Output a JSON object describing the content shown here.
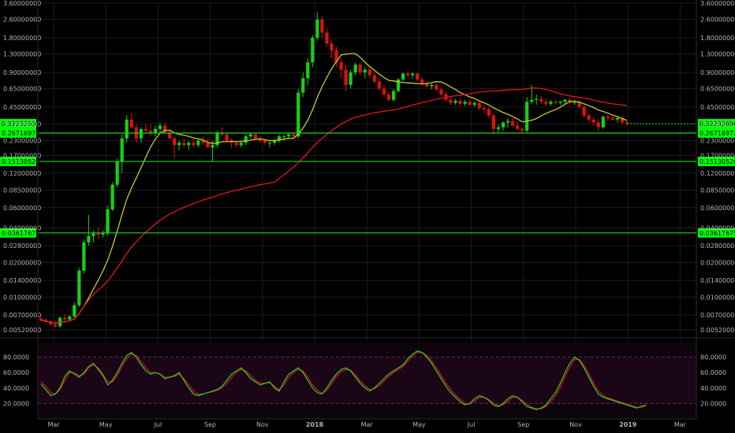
{
  "chart_data": {
    "type": "candlestick",
    "title": "",
    "y_scale": "log",
    "ylim": [
      0.0048,
      3.6
    ],
    "y_ticks": [
      "3.60000000",
      "2.60000000",
      "1.80000000",
      "1.30000000",
      "0.90000000",
      "0.65000000",
      "0.45000000",
      "0.32000000",
      "0.23000000",
      "0.17000000",
      "0.12000000",
      "0.08500000",
      "0.06000000",
      "0.04000000",
      "0.02800000",
      "0.02000000",
      "0.01400000",
      "0.01000000",
      "0.00700000",
      "0.00520000"
    ],
    "x_ticks": [
      "Mar",
      "May",
      "Jul",
      "Sep",
      "Nov",
      "2018",
      "Mar",
      "May",
      "Jul",
      "Sep",
      "Nov",
      "2019",
      "Mar"
    ],
    "current_price": {
      "label": "0.32232690",
      "value": 0.3223,
      "color": "#00ff00"
    },
    "horizontal_levels": [
      {
        "label": "0.26716972",
        "value": 0.2672
      },
      {
        "label": "0.15130520",
        "value": 0.1513
      },
      {
        "label": "0.03617675",
        "value": 0.0362
      }
    ],
    "candles": [
      {
        "week": 0,
        "o": 0.0065,
        "h": 0.0068,
        "l": 0.0062,
        "c": 0.0063
      },
      {
        "week": 1,
        "o": 0.0063,
        "h": 0.0066,
        "l": 0.006,
        "c": 0.0061
      },
      {
        "week": 2,
        "o": 0.0061,
        "h": 0.0064,
        "l": 0.0056,
        "c": 0.0058
      },
      {
        "week": 3,
        "o": 0.0058,
        "h": 0.0062,
        "l": 0.0054,
        "c": 0.0056
      },
      {
        "week": 4,
        "o": 0.0056,
        "h": 0.0068,
        "l": 0.0054,
        "c": 0.0066
      },
      {
        "week": 5,
        "o": 0.0066,
        "h": 0.0072,
        "l": 0.0062,
        "c": 0.0064
      },
      {
        "week": 6,
        "o": 0.0064,
        "h": 0.007,
        "l": 0.0062,
        "c": 0.0068
      },
      {
        "week": 7,
        "o": 0.0068,
        "h": 0.009,
        "l": 0.0066,
        "c": 0.0085
      },
      {
        "week": 8,
        "o": 0.0085,
        "h": 0.018,
        "l": 0.0082,
        "c": 0.017
      },
      {
        "week": 9,
        "o": 0.017,
        "h": 0.032,
        "l": 0.016,
        "c": 0.03
      },
      {
        "week": 10,
        "o": 0.03,
        "h": 0.052,
        "l": 0.028,
        "c": 0.034
      },
      {
        "week": 11,
        "o": 0.034,
        "h": 0.038,
        "l": 0.03,
        "c": 0.036
      },
      {
        "week": 12,
        "o": 0.036,
        "h": 0.04,
        "l": 0.032,
        "c": 0.035
      },
      {
        "week": 13,
        "o": 0.035,
        "h": 0.038,
        "l": 0.033,
        "c": 0.036
      },
      {
        "week": 14,
        "o": 0.036,
        "h": 0.062,
        "l": 0.034,
        "c": 0.058
      },
      {
        "week": 15,
        "o": 0.058,
        "h": 0.1,
        "l": 0.056,
        "c": 0.095
      },
      {
        "week": 16,
        "o": 0.095,
        "h": 0.16,
        "l": 0.09,
        "c": 0.15
      },
      {
        "week": 17,
        "o": 0.15,
        "h": 0.26,
        "l": 0.12,
        "c": 0.24
      },
      {
        "week": 18,
        "o": 0.24,
        "h": 0.38,
        "l": 0.22,
        "c": 0.35
      },
      {
        "week": 19,
        "o": 0.35,
        "h": 0.4,
        "l": 0.29,
        "c": 0.3
      },
      {
        "week": 20,
        "o": 0.3,
        "h": 0.32,
        "l": 0.22,
        "c": 0.24
      },
      {
        "week": 21,
        "o": 0.24,
        "h": 0.3,
        "l": 0.22,
        "c": 0.29
      },
      {
        "week": 22,
        "o": 0.29,
        "h": 0.32,
        "l": 0.27,
        "c": 0.28
      },
      {
        "week": 23,
        "o": 0.28,
        "h": 0.32,
        "l": 0.25,
        "c": 0.27
      },
      {
        "week": 24,
        "o": 0.27,
        "h": 0.31,
        "l": 0.25,
        "c": 0.29
      },
      {
        "week": 25,
        "o": 0.29,
        "h": 0.33,
        "l": 0.27,
        "c": 0.31
      },
      {
        "week": 26,
        "o": 0.31,
        "h": 0.33,
        "l": 0.27,
        "c": 0.27
      },
      {
        "week": 27,
        "o": 0.27,
        "h": 0.29,
        "l": 0.24,
        "c": 0.24
      },
      {
        "week": 28,
        "o": 0.24,
        "h": 0.25,
        "l": 0.16,
        "c": 0.21
      },
      {
        "week": 29,
        "o": 0.21,
        "h": 0.23,
        "l": 0.19,
        "c": 0.22
      },
      {
        "week": 30,
        "o": 0.22,
        "h": 0.24,
        "l": 0.2,
        "c": 0.21
      },
      {
        "week": 31,
        "o": 0.21,
        "h": 0.23,
        "l": 0.19,
        "c": 0.22
      },
      {
        "week": 32,
        "o": 0.22,
        "h": 0.24,
        "l": 0.2,
        "c": 0.21
      },
      {
        "week": 33,
        "o": 0.21,
        "h": 0.24,
        "l": 0.2,
        "c": 0.23
      },
      {
        "week": 34,
        "o": 0.23,
        "h": 0.25,
        "l": 0.21,
        "c": 0.22
      },
      {
        "week": 35,
        "o": 0.22,
        "h": 0.24,
        "l": 0.2,
        "c": 0.2
      },
      {
        "week": 36,
        "o": 0.2,
        "h": 0.23,
        "l": 0.15,
        "c": 0.21
      },
      {
        "week": 37,
        "o": 0.21,
        "h": 0.28,
        "l": 0.2,
        "c": 0.27
      },
      {
        "week": 38,
        "o": 0.27,
        "h": 0.3,
        "l": 0.25,
        "c": 0.26
      },
      {
        "week": 39,
        "o": 0.26,
        "h": 0.27,
        "l": 0.22,
        "c": 0.23
      },
      {
        "week": 40,
        "o": 0.23,
        "h": 0.24,
        "l": 0.2,
        "c": 0.22
      },
      {
        "week": 41,
        "o": 0.22,
        "h": 0.23,
        "l": 0.2,
        "c": 0.21
      },
      {
        "week": 42,
        "o": 0.21,
        "h": 0.23,
        "l": 0.2,
        "c": 0.22
      },
      {
        "week": 43,
        "o": 0.22,
        "h": 0.26,
        "l": 0.21,
        "c": 0.25
      },
      {
        "week": 44,
        "o": 0.25,
        "h": 0.27,
        "l": 0.24,
        "c": 0.26
      },
      {
        "week": 45,
        "o": 0.26,
        "h": 0.27,
        "l": 0.23,
        "c": 0.24
      },
      {
        "week": 46,
        "o": 0.24,
        "h": 0.25,
        "l": 0.22,
        "c": 0.23
      },
      {
        "week": 47,
        "o": 0.23,
        "h": 0.24,
        "l": 0.21,
        "c": 0.22
      },
      {
        "week": 48,
        "o": 0.22,
        "h": 0.23,
        "l": 0.2,
        "c": 0.22
      },
      {
        "week": 49,
        "o": 0.22,
        "h": 0.24,
        "l": 0.21,
        "c": 0.23
      },
      {
        "week": 50,
        "o": 0.23,
        "h": 0.26,
        "l": 0.22,
        "c": 0.25
      },
      {
        "week": 51,
        "o": 0.25,
        "h": 0.26,
        "l": 0.23,
        "c": 0.25
      },
      {
        "week": 52,
        "o": 0.25,
        "h": 0.27,
        "l": 0.24,
        "c": 0.26
      },
      {
        "week": 53,
        "o": 0.26,
        "h": 0.27,
        "l": 0.24,
        "c": 0.25
      },
      {
        "week": 54,
        "o": 0.25,
        "h": 0.65,
        "l": 0.24,
        "c": 0.6
      },
      {
        "week": 55,
        "o": 0.6,
        "h": 0.9,
        "l": 0.55,
        "c": 0.8
      },
      {
        "week": 56,
        "o": 0.8,
        "h": 1.2,
        "l": 0.7,
        "c": 1.1
      },
      {
        "week": 57,
        "o": 1.1,
        "h": 1.9,
        "l": 1.0,
        "c": 1.8
      },
      {
        "week": 58,
        "o": 1.8,
        "h": 3.0,
        "l": 1.7,
        "c": 2.6
      },
      {
        "week": 59,
        "o": 2.6,
        "h": 2.8,
        "l": 1.8,
        "c": 2.0
      },
      {
        "week": 60,
        "o": 2.0,
        "h": 2.2,
        "l": 1.5,
        "c": 1.6
      },
      {
        "week": 61,
        "o": 1.6,
        "h": 1.7,
        "l": 1.2,
        "c": 1.4
      },
      {
        "week": 62,
        "o": 1.4,
        "h": 1.5,
        "l": 1.0,
        "c": 1.1
      },
      {
        "week": 63,
        "o": 1.1,
        "h": 1.2,
        "l": 0.8,
        "c": 0.95
      },
      {
        "week": 64,
        "o": 0.95,
        "h": 1.05,
        "l": 0.62,
        "c": 0.7
      },
      {
        "week": 65,
        "o": 0.7,
        "h": 0.95,
        "l": 0.65,
        "c": 0.9
      },
      {
        "week": 66,
        "o": 0.9,
        "h": 1.1,
        "l": 0.85,
        "c": 1.05
      },
      {
        "week": 67,
        "o": 1.05,
        "h": 1.1,
        "l": 0.85,
        "c": 0.9
      },
      {
        "week": 68,
        "o": 0.9,
        "h": 1.0,
        "l": 0.8,
        "c": 0.95
      },
      {
        "week": 69,
        "o": 0.95,
        "h": 1.0,
        "l": 0.8,
        "c": 0.85
      },
      {
        "week": 70,
        "o": 0.85,
        "h": 0.9,
        "l": 0.72,
        "c": 0.75
      },
      {
        "week": 71,
        "o": 0.75,
        "h": 0.8,
        "l": 0.62,
        "c": 0.65
      },
      {
        "week": 72,
        "o": 0.65,
        "h": 0.7,
        "l": 0.55,
        "c": 0.58
      },
      {
        "week": 73,
        "o": 0.58,
        "h": 0.62,
        "l": 0.5,
        "c": 0.52
      },
      {
        "week": 74,
        "o": 0.52,
        "h": 0.65,
        "l": 0.5,
        "c": 0.62
      },
      {
        "week": 75,
        "o": 0.62,
        "h": 0.8,
        "l": 0.6,
        "c": 0.78
      },
      {
        "week": 76,
        "o": 0.78,
        "h": 0.9,
        "l": 0.75,
        "c": 0.88
      },
      {
        "week": 77,
        "o": 0.88,
        "h": 0.92,
        "l": 0.8,
        "c": 0.85
      },
      {
        "week": 78,
        "o": 0.85,
        "h": 0.9,
        "l": 0.8,
        "c": 0.88
      },
      {
        "week": 79,
        "o": 0.88,
        "h": 0.9,
        "l": 0.75,
        "c": 0.78
      },
      {
        "week": 80,
        "o": 0.78,
        "h": 0.82,
        "l": 0.7,
        "c": 0.72
      },
      {
        "week": 81,
        "o": 0.72,
        "h": 0.76,
        "l": 0.66,
        "c": 0.68
      },
      {
        "week": 82,
        "o": 0.68,
        "h": 0.72,
        "l": 0.64,
        "c": 0.7
      },
      {
        "week": 83,
        "o": 0.7,
        "h": 0.72,
        "l": 0.62,
        "c": 0.64
      },
      {
        "week": 84,
        "o": 0.64,
        "h": 0.66,
        "l": 0.56,
        "c": 0.58
      },
      {
        "week": 85,
        "o": 0.58,
        "h": 0.62,
        "l": 0.5,
        "c": 0.52
      },
      {
        "week": 86,
        "o": 0.52,
        "h": 0.56,
        "l": 0.47,
        "c": 0.49
      },
      {
        "week": 87,
        "o": 0.49,
        "h": 0.53,
        "l": 0.47,
        "c": 0.51
      },
      {
        "week": 88,
        "o": 0.51,
        "h": 0.53,
        "l": 0.46,
        "c": 0.48
      },
      {
        "week": 89,
        "o": 0.48,
        "h": 0.52,
        "l": 0.46,
        "c": 0.5
      },
      {
        "week": 90,
        "o": 0.5,
        "h": 0.52,
        "l": 0.46,
        "c": 0.47
      },
      {
        "week": 91,
        "o": 0.47,
        "h": 0.5,
        "l": 0.45,
        "c": 0.49
      },
      {
        "week": 92,
        "o": 0.49,
        "h": 0.5,
        "l": 0.42,
        "c": 0.44
      },
      {
        "week": 93,
        "o": 0.44,
        "h": 0.47,
        "l": 0.4,
        "c": 0.43
      },
      {
        "week": 94,
        "o": 0.43,
        "h": 0.45,
        "l": 0.36,
        "c": 0.38
      },
      {
        "week": 95,
        "o": 0.38,
        "h": 0.4,
        "l": 0.26,
        "c": 0.29
      },
      {
        "week": 96,
        "o": 0.29,
        "h": 0.32,
        "l": 0.27,
        "c": 0.3
      },
      {
        "week": 97,
        "o": 0.3,
        "h": 0.34,
        "l": 0.28,
        "c": 0.33
      },
      {
        "week": 98,
        "o": 0.33,
        "h": 0.36,
        "l": 0.3,
        "c": 0.34
      },
      {
        "week": 99,
        "o": 0.34,
        "h": 0.36,
        "l": 0.3,
        "c": 0.31
      },
      {
        "week": 100,
        "o": 0.31,
        "h": 0.34,
        "l": 0.28,
        "c": 0.29
      },
      {
        "week": 101,
        "o": 0.29,
        "h": 0.3,
        "l": 0.27,
        "c": 0.28
      },
      {
        "week": 102,
        "o": 0.28,
        "h": 0.55,
        "l": 0.27,
        "c": 0.5
      },
      {
        "week": 103,
        "o": 0.5,
        "h": 0.7,
        "l": 0.48,
        "c": 0.52
      },
      {
        "week": 104,
        "o": 0.52,
        "h": 0.58,
        "l": 0.47,
        "c": 0.53
      },
      {
        "week": 105,
        "o": 0.53,
        "h": 0.56,
        "l": 0.48,
        "c": 0.5
      },
      {
        "week": 106,
        "o": 0.5,
        "h": 0.54,
        "l": 0.46,
        "c": 0.48
      },
      {
        "week": 107,
        "o": 0.48,
        "h": 0.52,
        "l": 0.46,
        "c": 0.5
      },
      {
        "week": 108,
        "o": 0.5,
        "h": 0.52,
        "l": 0.47,
        "c": 0.49
      },
      {
        "week": 109,
        "o": 0.49,
        "h": 0.51,
        "l": 0.47,
        "c": 0.5
      },
      {
        "week": 110,
        "o": 0.5,
        "h": 0.53,
        "l": 0.48,
        "c": 0.52
      },
      {
        "week": 111,
        "o": 0.52,
        "h": 0.54,
        "l": 0.48,
        "c": 0.49
      },
      {
        "week": 112,
        "o": 0.49,
        "h": 0.52,
        "l": 0.47,
        "c": 0.5
      },
      {
        "week": 113,
        "o": 0.5,
        "h": 0.52,
        "l": 0.44,
        "c": 0.45
      },
      {
        "week": 114,
        "o": 0.45,
        "h": 0.47,
        "l": 0.36,
        "c": 0.38
      },
      {
        "week": 115,
        "o": 0.38,
        "h": 0.4,
        "l": 0.33,
        "c": 0.35
      },
      {
        "week": 116,
        "o": 0.35,
        "h": 0.37,
        "l": 0.31,
        "c": 0.33
      },
      {
        "week": 117,
        "o": 0.33,
        "h": 0.35,
        "l": 0.28,
        "c": 0.3
      },
      {
        "week": 118,
        "o": 0.3,
        "h": 0.38,
        "l": 0.29,
        "c": 0.37
      },
      {
        "week": 119,
        "o": 0.37,
        "h": 0.39,
        "l": 0.34,
        "c": 0.36
      },
      {
        "week": 120,
        "o": 0.36,
        "h": 0.38,
        "l": 0.34,
        "c": 0.35
      },
      {
        "week": 121,
        "o": 0.35,
        "h": 0.37,
        "l": 0.33,
        "c": 0.36
      },
      {
        "week": 122,
        "o": 0.36,
        "h": 0.38,
        "l": 0.32,
        "c": 0.33
      },
      {
        "week": 123,
        "o": 0.33,
        "h": 0.34,
        "l": 0.31,
        "c": 0.3223
      }
    ],
    "sma_fast": {
      "color": "#c8c832",
      "period": 10
    },
    "sma_slow": {
      "color": "#e01818",
      "period": 50
    },
    "stochastic": {
      "ylim": [
        0,
        100
      ],
      "y_ticks": [
        "80.0000",
        "60.0000",
        "40.0000",
        "20.0000"
      ],
      "bands": [
        80,
        20
      ],
      "k": [
        45,
        38,
        30,
        32,
        40,
        55,
        62,
        58,
        54,
        60,
        68,
        72,
        64,
        56,
        44,
        50,
        60,
        72,
        82,
        86,
        80,
        70,
        62,
        58,
        60,
        58,
        52,
        54,
        56,
        60,
        50,
        40,
        32,
        30,
        32,
        34,
        36,
        38,
        42,
        50,
        58,
        62,
        66,
        60,
        52,
        48,
        44,
        46,
        48,
        40,
        36,
        48,
        58,
        62,
        66,
        60,
        50,
        40,
        34,
        32,
        40,
        50,
        58,
        64,
        66,
        62,
        54,
        46,
        40,
        36,
        40,
        46,
        52,
        58,
        62,
        66,
        70,
        78,
        84,
        88,
        86,
        80,
        72,
        62,
        52,
        42,
        34,
        28,
        22,
        18,
        20,
        26,
        30,
        28,
        24,
        18,
        16,
        20,
        26,
        30,
        28,
        22,
        16,
        14,
        12,
        14,
        18,
        26,
        34,
        46,
        60,
        72,
        80,
        76,
        66,
        54,
        42,
        32,
        28,
        26,
        24,
        22,
        20,
        18,
        16,
        14,
        16,
        18
      ],
      "d": [
        48,
        42,
        34,
        32,
        38,
        50,
        60,
        60,
        56,
        58,
        66,
        70,
        66,
        58,
        48,
        48,
        56,
        68,
        78,
        84,
        82,
        74,
        66,
        60,
        60,
        58,
        54,
        54,
        55,
        58,
        52,
        44,
        36,
        32,
        32,
        34,
        35,
        37,
        40,
        46,
        54,
        60,
        64,
        62,
        56,
        50,
        46,
        46,
        47,
        42,
        38,
        44,
        54,
        60,
        64,
        62,
        54,
        44,
        37,
        33,
        37,
        46,
        55,
        61,
        64,
        63,
        57,
        49,
        43,
        38,
        39,
        43,
        49,
        55,
        60,
        64,
        68,
        75,
        81,
        86,
        86,
        82,
        75,
        66,
        56,
        46,
        38,
        31,
        25,
        20,
        19,
        23,
        28,
        28,
        25,
        20,
        17,
        18,
        23,
        28,
        28,
        24,
        19,
        15,
        13,
        13,
        16,
        22,
        30,
        41,
        55,
        67,
        77,
        77,
        69,
        58,
        46,
        36,
        30,
        27,
        25,
        23,
        21,
        19,
        17,
        15,
        15,
        17
      ]
    }
  }
}
